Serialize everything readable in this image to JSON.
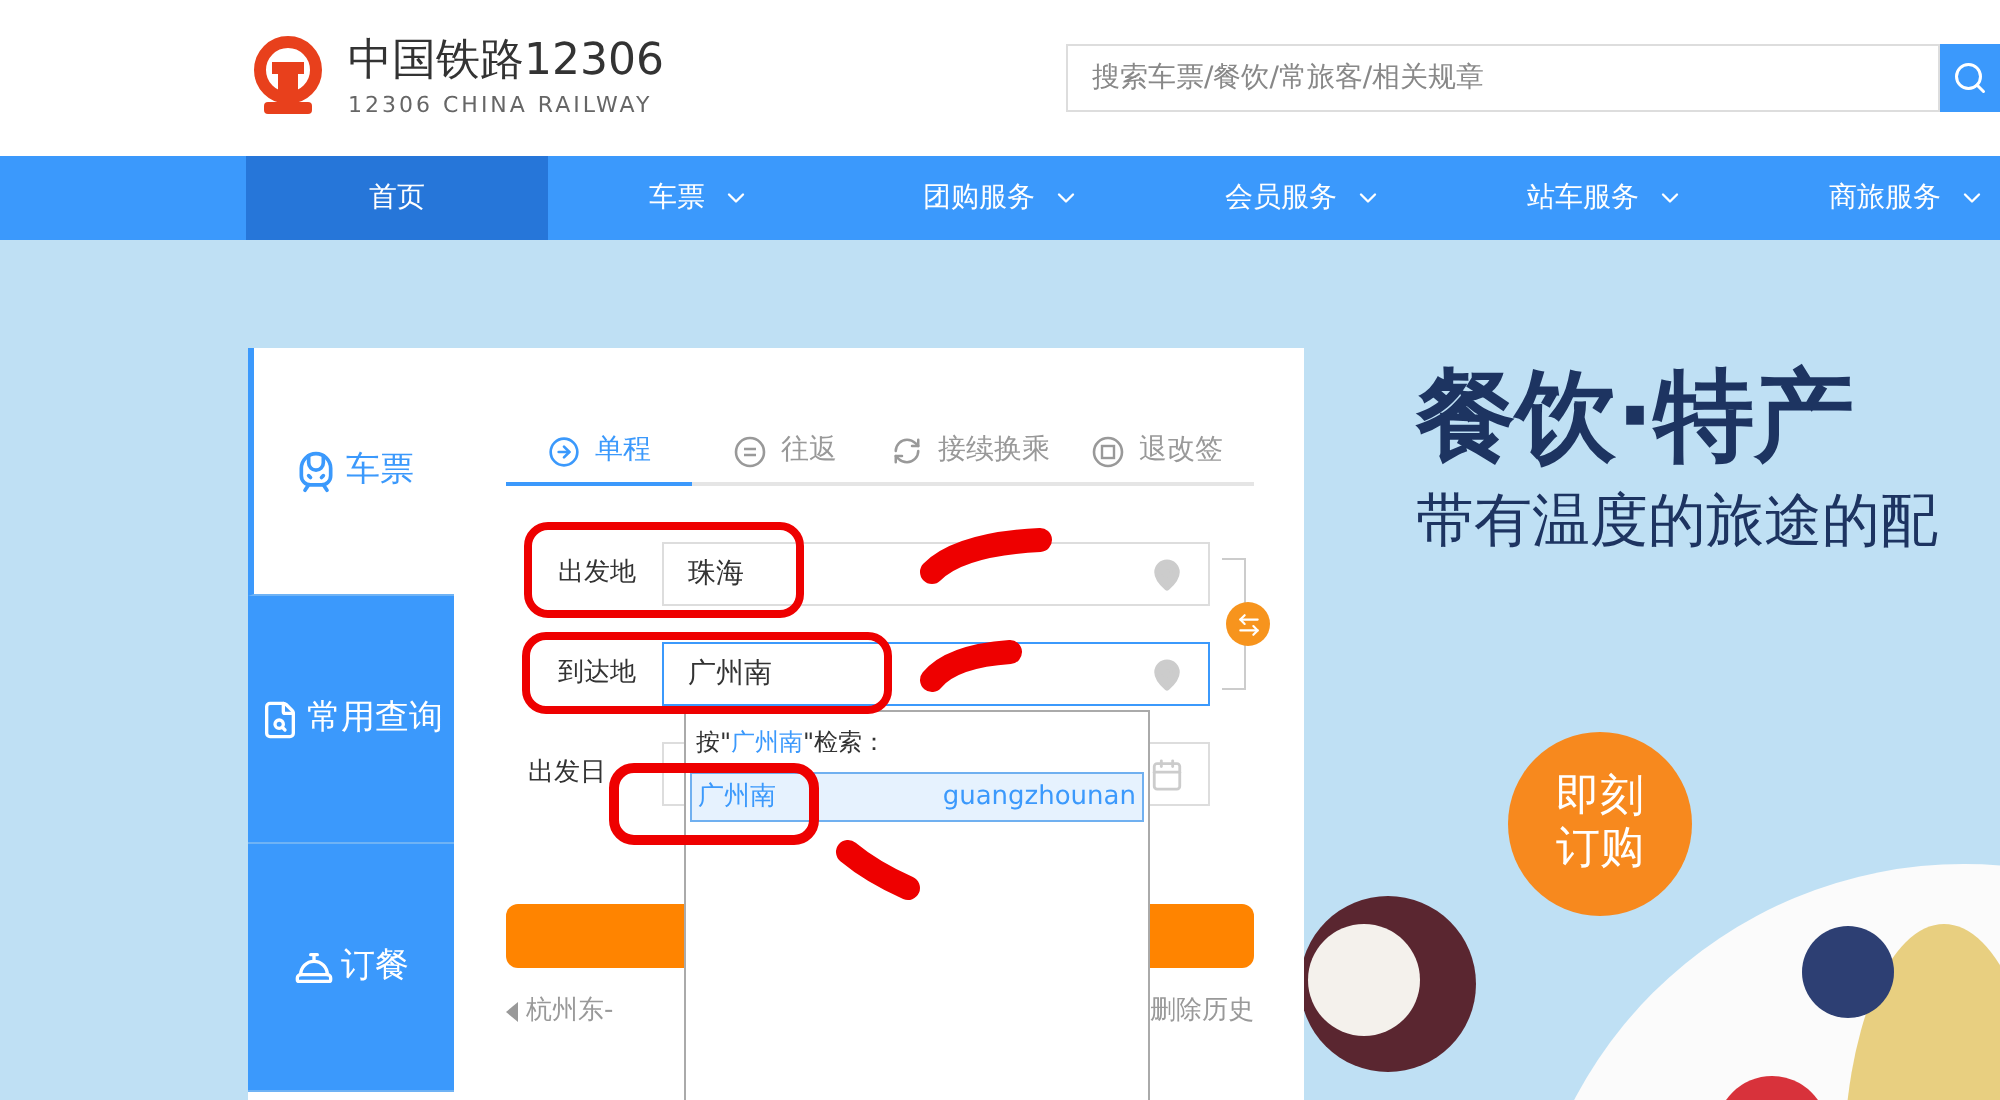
{
  "header": {
    "logo_title": "中国铁路12306",
    "logo_subtitle": "12306 CHINA RAILWAY",
    "search": {
      "placeholder": "搜索车票/餐饮/常旅客/相关规章"
    }
  },
  "nav": [
    {
      "label": "首页",
      "selected": true,
      "has_menu": false
    },
    {
      "label": "车票",
      "selected": false,
      "has_menu": true
    },
    {
      "label": "团购服务",
      "selected": false,
      "has_menu": true
    },
    {
      "label": "会员服务",
      "selected": false,
      "has_menu": true
    },
    {
      "label": "站车服务",
      "selected": false,
      "has_menu": true
    },
    {
      "label": "商旅服务",
      "selected": false,
      "has_menu": true
    }
  ],
  "side_tabs": [
    {
      "label": "车票",
      "selected": true,
      "kind": "train"
    },
    {
      "label": "常用查询",
      "selected": false,
      "kind": "query"
    },
    {
      "label": "订餐",
      "selected": false,
      "kind": "meal"
    }
  ],
  "trip_tabs": [
    {
      "label": "单程",
      "selected": true,
      "kind": "oneway"
    },
    {
      "label": "往返",
      "selected": false,
      "kind": "return"
    },
    {
      "label": "接续换乘",
      "selected": false,
      "kind": "transfer"
    },
    {
      "label": "退改签",
      "selected": false,
      "kind": "refund"
    }
  ],
  "fields": [
    {
      "label": "出发地",
      "value": "珠海",
      "focused": false
    },
    {
      "label": "到达地",
      "value": "广州南",
      "focused": true
    }
  ],
  "date_field": {
    "label": "出发日"
  },
  "history": {
    "item": "杭州东-",
    "clear": "删除历史"
  },
  "dropdown": {
    "prompt_before": "按\"",
    "query": "广州南",
    "prompt_after": "\"检索：",
    "options": [
      {
        "name": "广州南",
        "pinyin": "guangzhounan",
        "selected": true
      }
    ]
  },
  "banner": {
    "title": "餐饮·特产",
    "subtitle": "带有温度的旅途的配",
    "badge": "即刻订购"
  }
}
